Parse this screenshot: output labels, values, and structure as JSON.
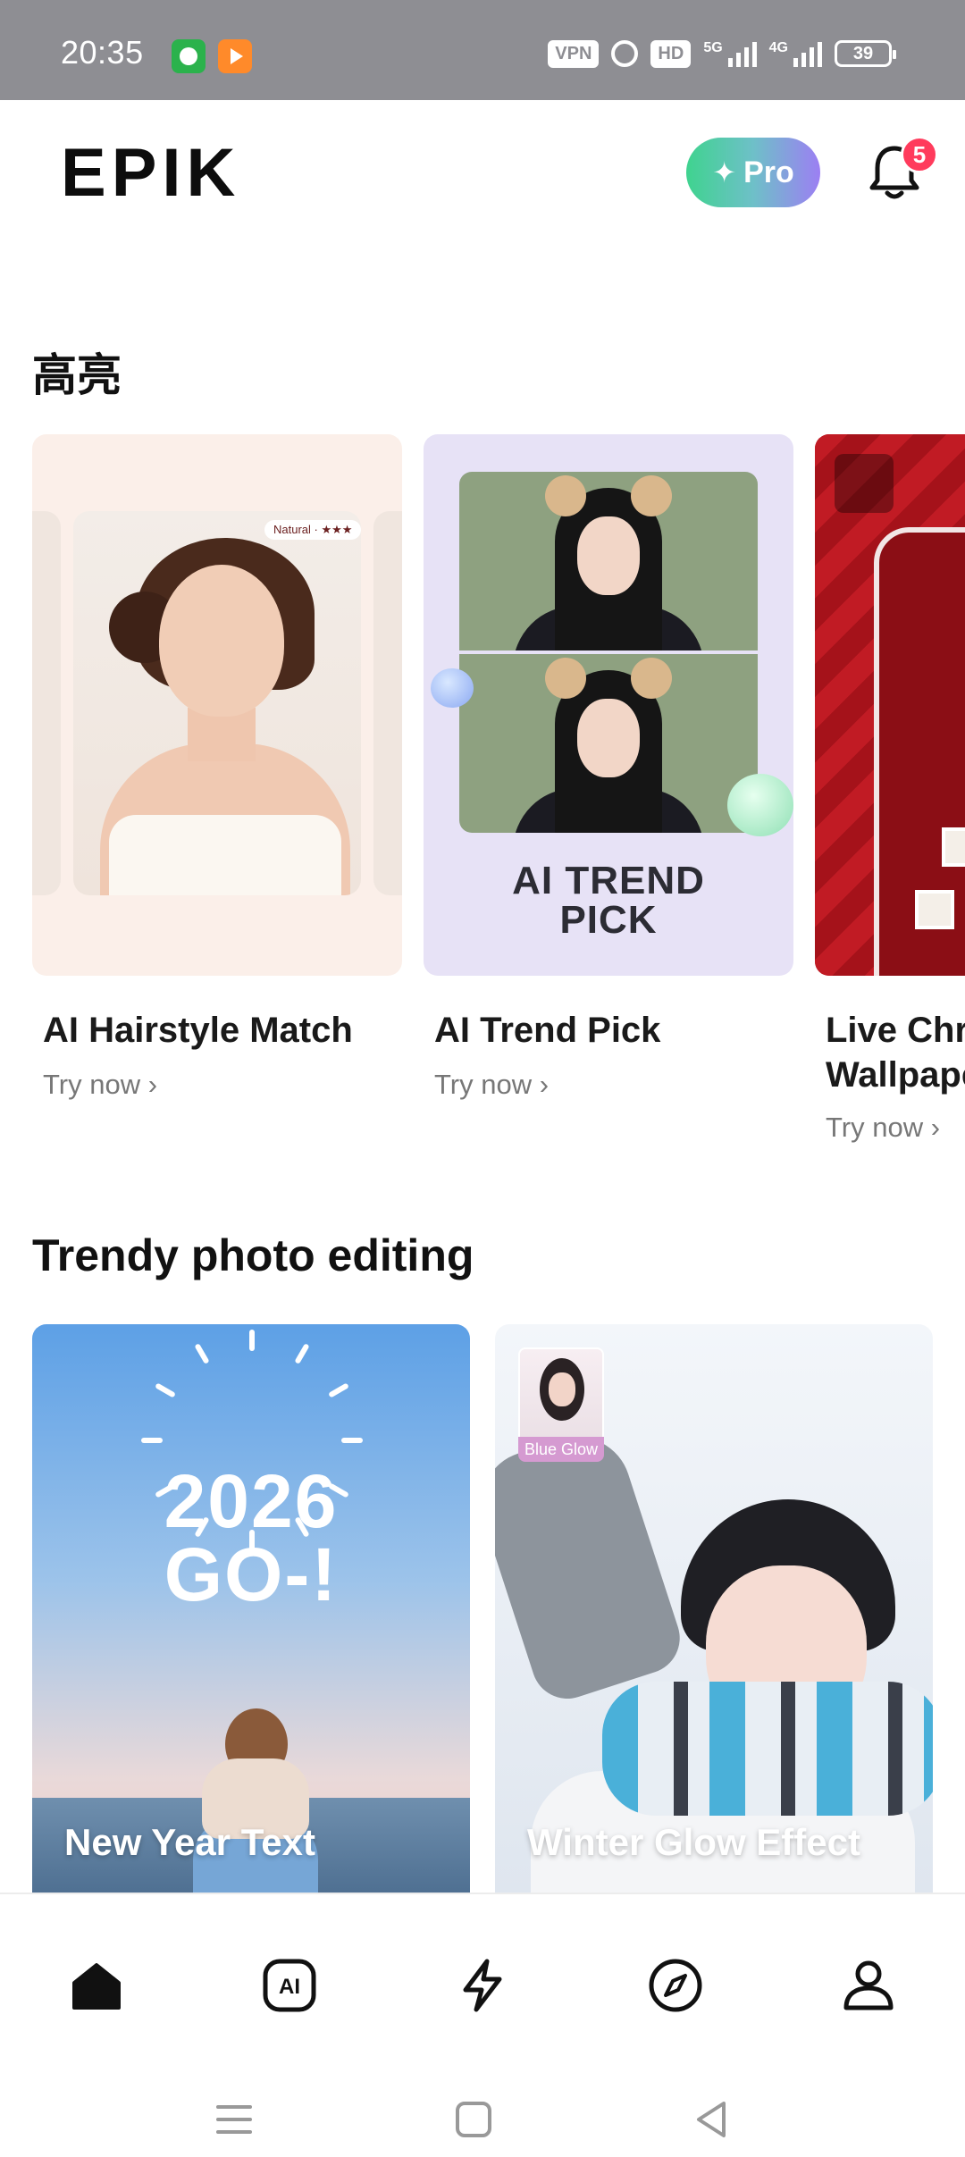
{
  "status_bar": {
    "time": "20:35",
    "vpn_label": "VPN",
    "hd_label": "HD",
    "network_1": "5G",
    "network_2": "4G",
    "battery": "39",
    "icons": [
      "messaging-app-icon",
      "video-app-icon",
      "alarm-icon",
      "signal-icon",
      "battery-icon"
    ]
  },
  "header": {
    "logo": "EPIK",
    "pro_label": "Pro",
    "pro_icon": "sparkle-icon",
    "notification_count": "5",
    "notification_icon": "bell-icon"
  },
  "highlights": {
    "title": "高亮",
    "items": [
      {
        "title": "AI Hairstyle Match",
        "action": "Try now",
        "tag": "Natural · ★★★"
      },
      {
        "title": "AI Trend Pick",
        "action": "Try now",
        "image_text": "AI TREND\nPICK"
      },
      {
        "title": "Live Chri\nWallpape",
        "action": "Try now"
      }
    ]
  },
  "trendy": {
    "title": "Trendy photo editing",
    "items": [
      {
        "title": "New Year Text",
        "image_text_1": "2026",
        "image_text_2": "GO-!"
      },
      {
        "title": "Winter Glow Effect",
        "thumb_label": "Blue Glow"
      }
    ]
  },
  "bottom_nav": {
    "items": [
      "home-icon",
      "ai-icon",
      "lightning-icon",
      "compass-icon",
      "profile-icon"
    ],
    "active_index": 0,
    "ai_glyph": "AI"
  },
  "system_nav": [
    "menu-icon",
    "home-square-icon",
    "back-icon"
  ],
  "colors": {
    "status_bar": "#8e8e93",
    "pro_gradient_start": "#3fd38f",
    "pro_gradient_end": "#9c7ff3",
    "badge": "#ff3b5c",
    "text_primary": "#111111",
    "text_secondary": "#777777"
  }
}
